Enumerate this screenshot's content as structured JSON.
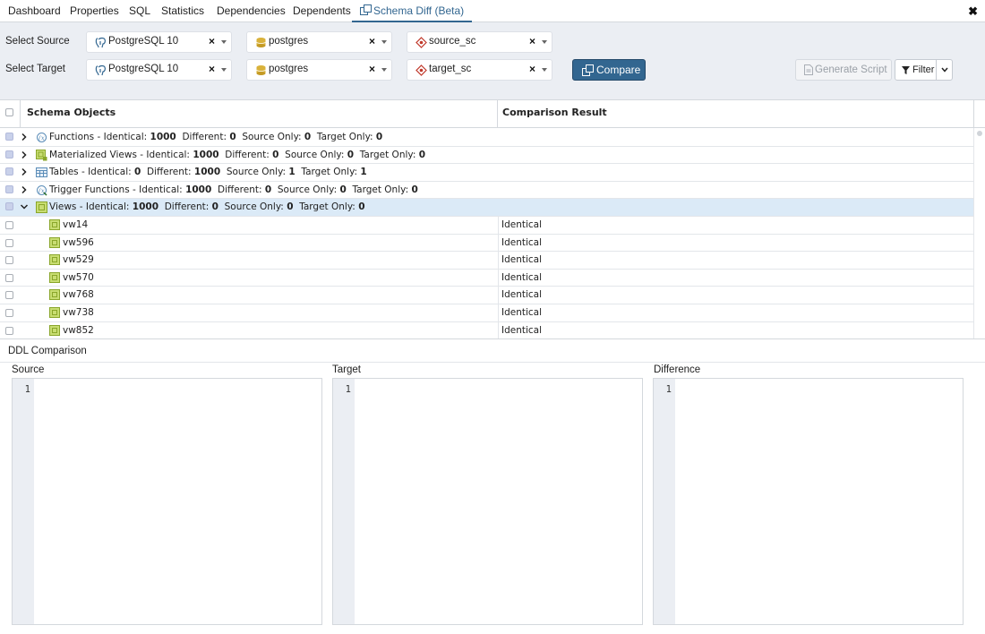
{
  "tabs": [
    {
      "label": "Dashboard"
    },
    {
      "label": "Properties"
    },
    {
      "label": "SQL"
    },
    {
      "label": "Statistics"
    },
    {
      "label": "Dependencies"
    },
    {
      "label": "Dependents"
    },
    {
      "label": "Schema Diff (Beta)",
      "active": true
    }
  ],
  "close_glyph": "✖",
  "source": {
    "label": "Select Source",
    "server": "PostgreSQL 10",
    "database": "postgres",
    "schema": "source_sc"
  },
  "target": {
    "label": "Select Target",
    "server": "PostgreSQL 10",
    "database": "postgres",
    "schema": "target_sc"
  },
  "clear_glyph": "×",
  "buttons": {
    "compare": "Compare",
    "generate_script": "Generate Script",
    "filter": "Filter"
  },
  "grid": {
    "headers": [
      "Schema Objects",
      "Comparison Result"
    ],
    "groups": [
      {
        "name": "Functions - Identical:",
        "identical": "1000",
        "different": "0",
        "source_only": "0",
        "target_only": "0",
        "expanded": false,
        "icon": "function-icon"
      },
      {
        "name": "Materialized Views - Identical:",
        "identical": "1000",
        "different": "0",
        "source_only": "0",
        "target_only": "0",
        "expanded": false,
        "icon": "materialized-view-icon"
      },
      {
        "name": "Tables - Identical:",
        "identical": "0",
        "different": "1000",
        "source_only": "1",
        "target_only": "1",
        "expanded": false,
        "icon": "table-icon"
      },
      {
        "name": "Trigger Functions - Identical:",
        "identical": "1000",
        "different": "0",
        "source_only": "0",
        "target_only": "0",
        "expanded": false,
        "icon": "trigger-function-icon"
      },
      {
        "name": "Views - Identical:",
        "identical": "1000",
        "different": "0",
        "source_only": "0",
        "target_only": "0",
        "expanded": true,
        "icon": "view-icon"
      }
    ],
    "labels": {
      "different": "Different:",
      "source_only": "Source Only:",
      "target_only": "Target Only:"
    },
    "children": [
      {
        "name": "vw14",
        "result": "Identical"
      },
      {
        "name": "vw596",
        "result": "Identical"
      },
      {
        "name": "vw529",
        "result": "Identical"
      },
      {
        "name": "vw570",
        "result": "Identical"
      },
      {
        "name": "vw768",
        "result": "Identical"
      },
      {
        "name": "vw738",
        "result": "Identical"
      },
      {
        "name": "vw852",
        "result": "Identical"
      }
    ]
  },
  "ddl": {
    "title": "DDL Comparison",
    "panes": [
      {
        "label": "Source",
        "line": "1"
      },
      {
        "label": "Target",
        "line": "1"
      },
      {
        "label": "Difference",
        "line": "1"
      }
    ]
  },
  "colors": {
    "accent": "#326690",
    "panel_bg": "#ebeef3",
    "selected_row": "#dbeaf7",
    "view_icon": "#a4c639"
  }
}
